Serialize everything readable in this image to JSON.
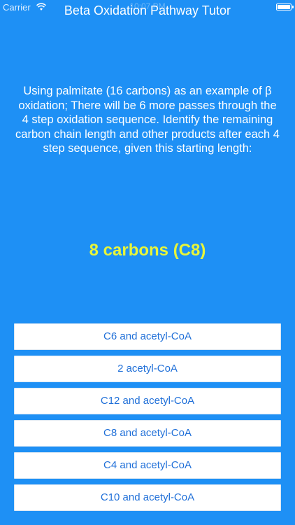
{
  "status_bar": {
    "carrier": "Carrier",
    "time": "10:07 PM",
    "icons": [
      "wifi-icon",
      "battery-icon"
    ]
  },
  "nav": {
    "title": "Beta Oxidation Pathway Tutor"
  },
  "question": {
    "text": "Using palmitate (16 carbons) as an example of β oxidation; There will be 6 more passes through the 4 step oxidation sequence. Identify the remaining carbon chain length and other products after each 4 step sequence, given this starting length:"
  },
  "prompt": {
    "text": "8 carbons (C8)"
  },
  "answers": [
    {
      "label": "C6 and acetyl-CoA"
    },
    {
      "label": "2 acetyl-CoA"
    },
    {
      "label": "C12 and acetyl-CoA"
    },
    {
      "label": "C8 and acetyl-CoA"
    },
    {
      "label": "C4 and acetyl-CoA"
    },
    {
      "label": "C10 and acetyl-CoA"
    }
  ],
  "colors": {
    "background": "#1e90f5",
    "prompt": "#e7f53a",
    "button_text": "#1f6fd8",
    "button_bg": "#ffffff"
  }
}
